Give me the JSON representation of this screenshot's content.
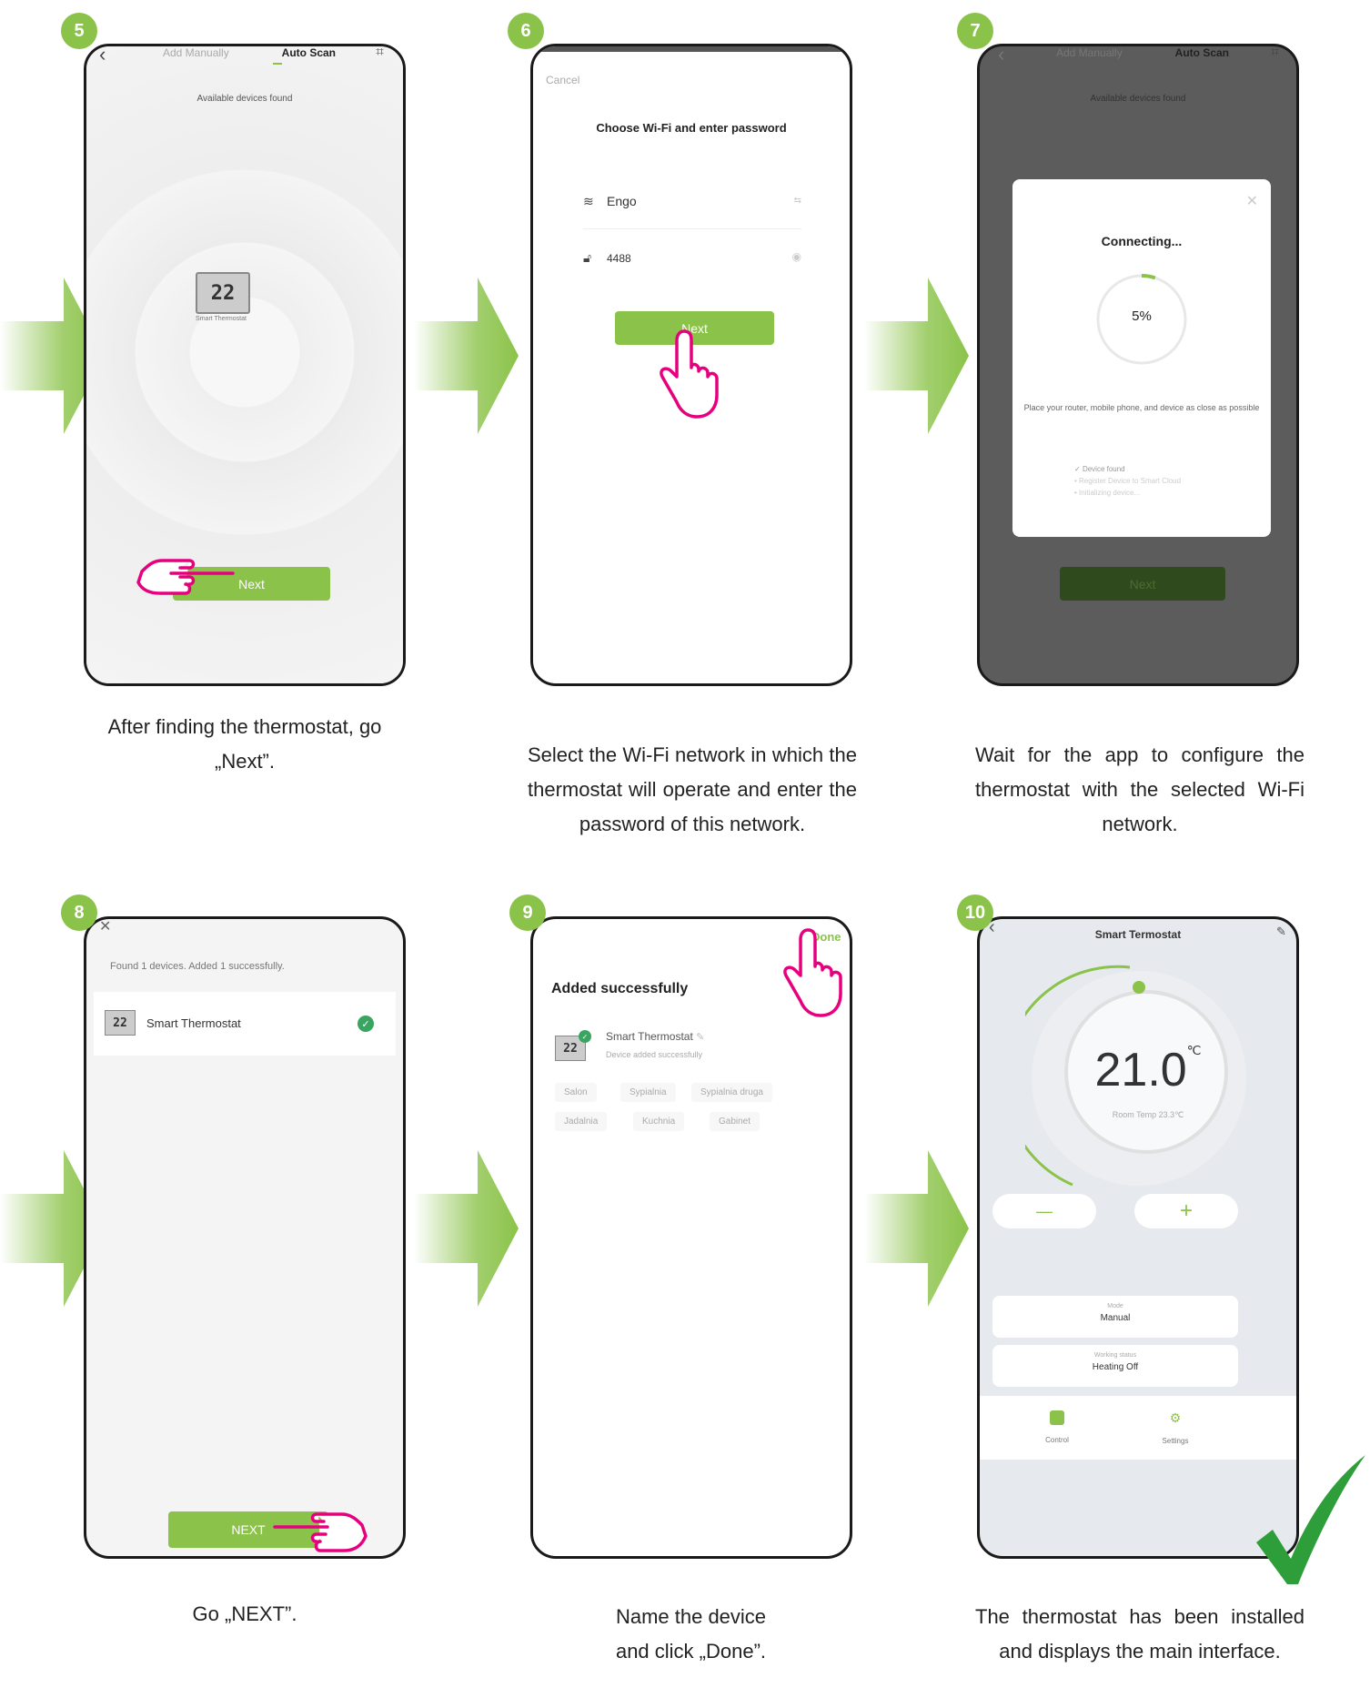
{
  "steps": [
    {
      "number": "5",
      "caption": "After finding the thermostat, go „Next”."
    },
    {
      "number": "6",
      "caption": "Select the Wi-Fi network in which the thermostat will operate and enter the password of this network."
    },
    {
      "number": "7",
      "caption": "Wait for the app to configure the thermostat with the selected Wi-Fi network."
    },
    {
      "number": "8",
      "caption": "Go „NEXT”."
    },
    {
      "number": "9",
      "caption": "Name the device and click „Done”."
    },
    {
      "number": "10",
      "caption": "The thermostat has been installed and displays the main interface."
    }
  ],
  "screen5": {
    "tab_manual": "Add Manually",
    "tab_auto": "Auto Scan",
    "found_text": "Available devices found",
    "device_display": "22",
    "device_name": "Smart Thermostat",
    "next_label": "Next"
  },
  "screen6": {
    "cancel": "Cancel",
    "title": "Choose Wi-Fi and enter password",
    "wifi_name": "Engo",
    "wifi_switch": "⇆",
    "password": "4488",
    "next_label": "Next"
  },
  "screen7": {
    "tab_manual": "Add Manually",
    "tab_auto": "Auto Scan",
    "found_text": "Available devices found",
    "connecting": "Connecting...",
    "percent": "5%",
    "progress": 0.05,
    "hint": "Place your router, mobile phone, and device as close as possible",
    "step1": "Device found",
    "step2": "Register Device to Smart Cloud",
    "step3": "Initializing device...",
    "next_label": "Next"
  },
  "screen8": {
    "found_text": "Found 1 devices. Added 1 successfully.",
    "device_display": "22",
    "device_name": "Smart Thermostat",
    "next_label": "NEXT"
  },
  "screen9": {
    "done": "Done",
    "title": "Added successfully",
    "device_display": "22",
    "device_name": "Smart Thermostat",
    "device_status": "Device added successfully",
    "rooms": [
      "Salon",
      "Sypialnia",
      "Sypialnia druga",
      "Jadalnia",
      "Kuchnia",
      "Gabinet"
    ]
  },
  "screen10": {
    "title": "Smart Termostat",
    "temperature": "21.0",
    "unit": "℃",
    "room_temp": "Room Temp 23.3℃",
    "minus": "—",
    "plus": "+",
    "mode_label": "Mode",
    "mode_value": "Manual",
    "status_label": "Working status",
    "status_value": "Heating Off",
    "nav_control": "Control",
    "nav_settings": "Settings"
  },
  "colors": {
    "accent": "#8bc34a",
    "hand": "#e6007e",
    "check": "#2e9e3a"
  }
}
